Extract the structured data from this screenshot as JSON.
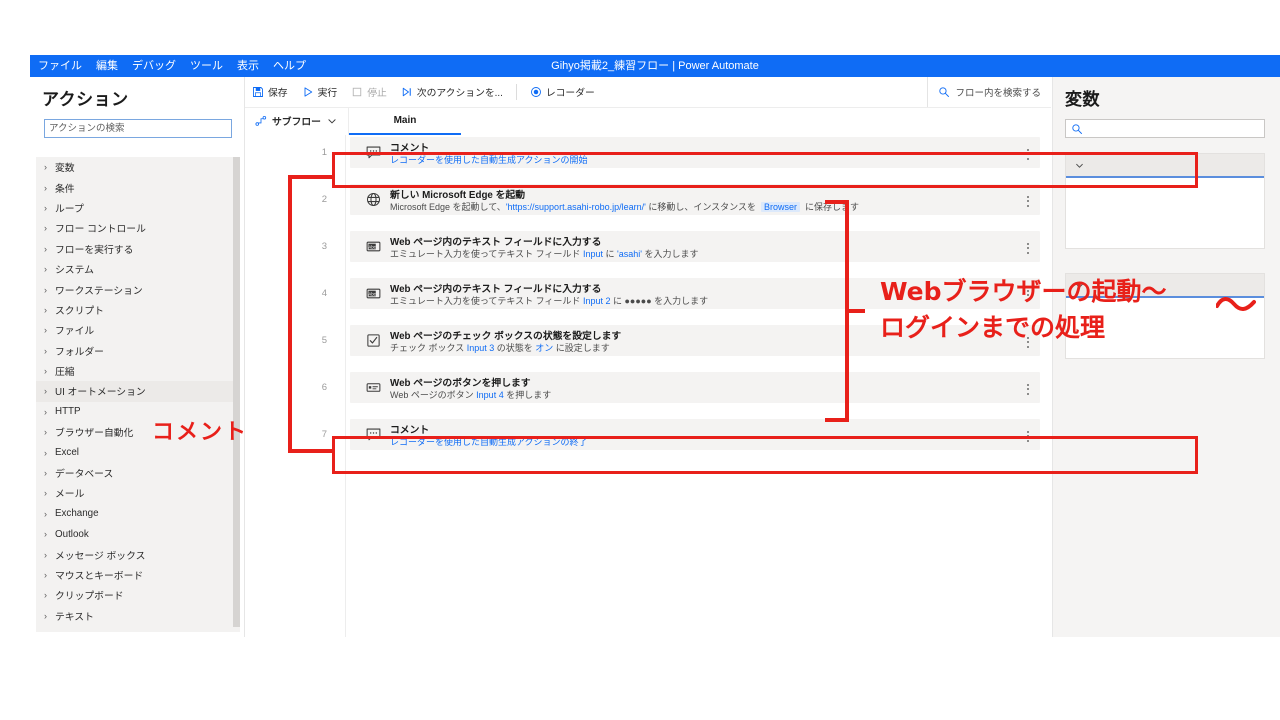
{
  "window": {
    "title": "Gihyo掲載2_練習フロー | Power Automate",
    "accent": "#0f6cf5"
  },
  "menubar": {
    "items": [
      {
        "label": "ファイル"
      },
      {
        "label": "編集"
      },
      {
        "label": "デバッグ"
      },
      {
        "label": "ツール"
      },
      {
        "label": "表示"
      },
      {
        "label": "ヘルプ"
      }
    ]
  },
  "actions_panel": {
    "title": "アクション",
    "search_placeholder": "アクションの検索",
    "search_value": "",
    "categories": [
      {
        "label": "変数",
        "selected": false
      },
      {
        "label": "条件",
        "selected": false
      },
      {
        "label": "ループ",
        "selected": false
      },
      {
        "label": "フロー コントロール",
        "selected": false
      },
      {
        "label": "フローを実行する",
        "selected": false
      },
      {
        "label": "システム",
        "selected": false
      },
      {
        "label": "ワークステーション",
        "selected": false
      },
      {
        "label": "スクリプト",
        "selected": false
      },
      {
        "label": "ファイル",
        "selected": false
      },
      {
        "label": "フォルダー",
        "selected": false
      },
      {
        "label": "圧縮",
        "selected": false
      },
      {
        "label": "UI オートメーション",
        "selected": true
      },
      {
        "label": "HTTP",
        "selected": false
      },
      {
        "label": "ブラウザー自動化",
        "selected": false
      },
      {
        "label": "Excel",
        "selected": false
      },
      {
        "label": "データベース",
        "selected": false
      },
      {
        "label": "メール",
        "selected": false
      },
      {
        "label": "Exchange",
        "selected": false
      },
      {
        "label": "Outlook",
        "selected": false
      },
      {
        "label": "メッセージ ボックス",
        "selected": false
      },
      {
        "label": "マウスとキーボード",
        "selected": false
      },
      {
        "label": "クリップボード",
        "selected": false
      },
      {
        "label": "テキスト",
        "selected": false
      }
    ]
  },
  "toolbar": {
    "save_label": "保存",
    "run_label": "実行",
    "stop_label": "停止",
    "next_action_label": "次のアクションを...",
    "recorder_label": "レコーダー",
    "flow_search_placeholder": "フロー内を検索する"
  },
  "tabs": {
    "subflow_label": "サブフロー",
    "main_label": "Main"
  },
  "flow": {
    "steps": [
      {
        "num": "1",
        "icon": "comment-icon",
        "title": "コメント",
        "desc_html": "<span class=\"v\">レコーダーを使用した自動生成アクションの開始</span>",
        "desc_plain": "レコーダーを使用した自動生成アクションの開始"
      },
      {
        "num": "2",
        "icon": "globe-icon",
        "title": "新しい Microsoft Edge を起動",
        "desc_html": "Microsoft Edge を起動して、<span class=\"vq\">'https://support.asahi-robo.jp/learn/'</span> に移動し、インスタンスを&nbsp; <span class=\"badge\">Browser</span> &nbsp;に保存します",
        "desc_plain": "Microsoft Edge を起動して、'https://support.asahi-robo.jp/learn/' に移動し、インスタンスを Browser に保存します"
      },
      {
        "num": "3",
        "icon": "textfield-icon",
        "title": "Web ページ内のテキスト フィールドに入力する",
        "desc_html": "エミュレート入力を使ってテキスト フィールド <span class=\"v\">Input</span> に <span class=\"v\">'asahi'</span> を入力します",
        "desc_plain": "エミュレート入力を使ってテキスト フィールド Input に 'asahi' を入力します"
      },
      {
        "num": "4",
        "icon": "textfield-icon",
        "title": "Web ページ内のテキスト フィールドに入力する",
        "desc_html": "エミュレート入力を使ってテキスト フィールド <span class=\"v\">Input 2</span> に ●●●●● を入力します",
        "desc_plain": "エミュレート入力を使ってテキスト フィールド Input 2 に ●●●●● を入力します"
      },
      {
        "num": "5",
        "icon": "checkbox-icon",
        "title": "Web ページのチェック ボックスの状態を設定します",
        "desc_html": "チェック ボックス <span class=\"v\">Input 3</span> の状態を <span class=\"v\">オン</span> に設定します",
        "desc_plain": "チェック ボックス Input 3 の状態を オン に設定します"
      },
      {
        "num": "6",
        "icon": "button-icon",
        "title": "Web ページのボタンを押します",
        "desc_html": "Web ページのボタン <span class=\"v\">Input 4</span> を押します",
        "desc_plain": "Web ページのボタン Input 4 を押します"
      },
      {
        "num": "7",
        "icon": "comment-icon",
        "title": "コメント",
        "desc_html": "<span class=\"v\">レコーダーを使用した自動生成アクションの終了</span>",
        "desc_plain": "レコーダーを使用した自動生成アクションの終了"
      }
    ]
  },
  "variables_panel": {
    "title": "変数",
    "search_placeholder": ""
  },
  "annotations": {
    "color": "#e8201a",
    "comment_label": "コメント",
    "browser_label_line1": "Webブラウザーの起動〜",
    "browser_label_line2": "ログインまでの処理"
  }
}
